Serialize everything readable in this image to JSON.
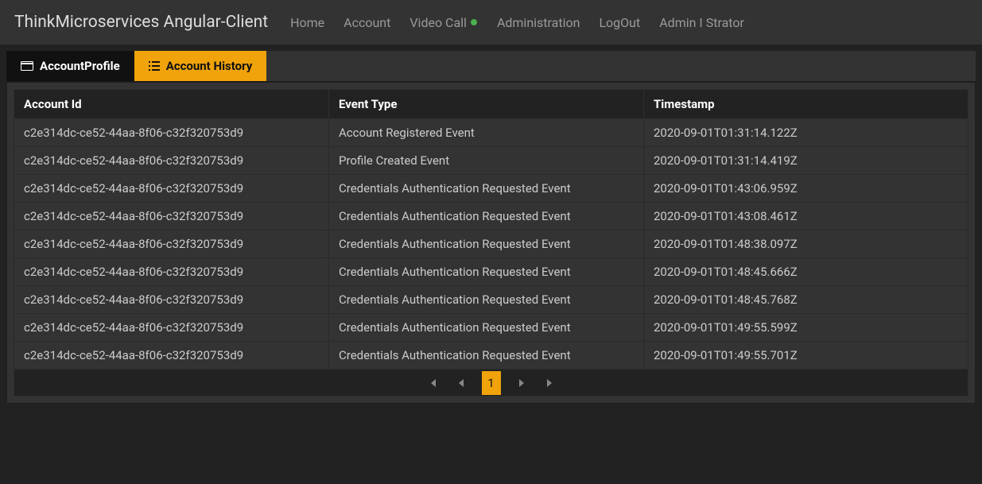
{
  "navbar": {
    "brand": "ThinkMicroservices Angular-Client",
    "links": {
      "home": "Home",
      "account": "Account",
      "video_call": "Video Call",
      "administration": "Administration",
      "logout": "LogOut",
      "user": "Admin I Strator"
    }
  },
  "tabs": {
    "profile": "AccountProfile",
    "history": "Account History"
  },
  "table": {
    "headers": {
      "account_id": "Account Id",
      "event_type": "Event Type",
      "timestamp": "Timestamp"
    },
    "rows": [
      {
        "id": "c2e314dc-ce52-44aa-8f06-c32f320753d9",
        "event": "Account Registered Event",
        "ts": "2020-09-01T01:31:14.122Z"
      },
      {
        "id": "c2e314dc-ce52-44aa-8f06-c32f320753d9",
        "event": "Profile Created Event",
        "ts": "2020-09-01T01:31:14.419Z"
      },
      {
        "id": "c2e314dc-ce52-44aa-8f06-c32f320753d9",
        "event": "Credentials Authentication Requested Event",
        "ts": "2020-09-01T01:43:06.959Z"
      },
      {
        "id": "c2e314dc-ce52-44aa-8f06-c32f320753d9",
        "event": "Credentials Authentication Requested Event",
        "ts": "2020-09-01T01:43:08.461Z"
      },
      {
        "id": "c2e314dc-ce52-44aa-8f06-c32f320753d9",
        "event": "Credentials Authentication Requested Event",
        "ts": "2020-09-01T01:48:38.097Z"
      },
      {
        "id": "c2e314dc-ce52-44aa-8f06-c32f320753d9",
        "event": "Credentials Authentication Requested Event",
        "ts": "2020-09-01T01:48:45.666Z"
      },
      {
        "id": "c2e314dc-ce52-44aa-8f06-c32f320753d9",
        "event": "Credentials Authentication Requested Event",
        "ts": "2020-09-01T01:48:45.768Z"
      },
      {
        "id": "c2e314dc-ce52-44aa-8f06-c32f320753d9",
        "event": "Credentials Authentication Requested Event",
        "ts": "2020-09-01T01:49:55.599Z"
      },
      {
        "id": "c2e314dc-ce52-44aa-8f06-c32f320753d9",
        "event": "Credentials Authentication Requested Event",
        "ts": "2020-09-01T01:49:55.701Z"
      }
    ]
  },
  "pager": {
    "current": "1"
  }
}
